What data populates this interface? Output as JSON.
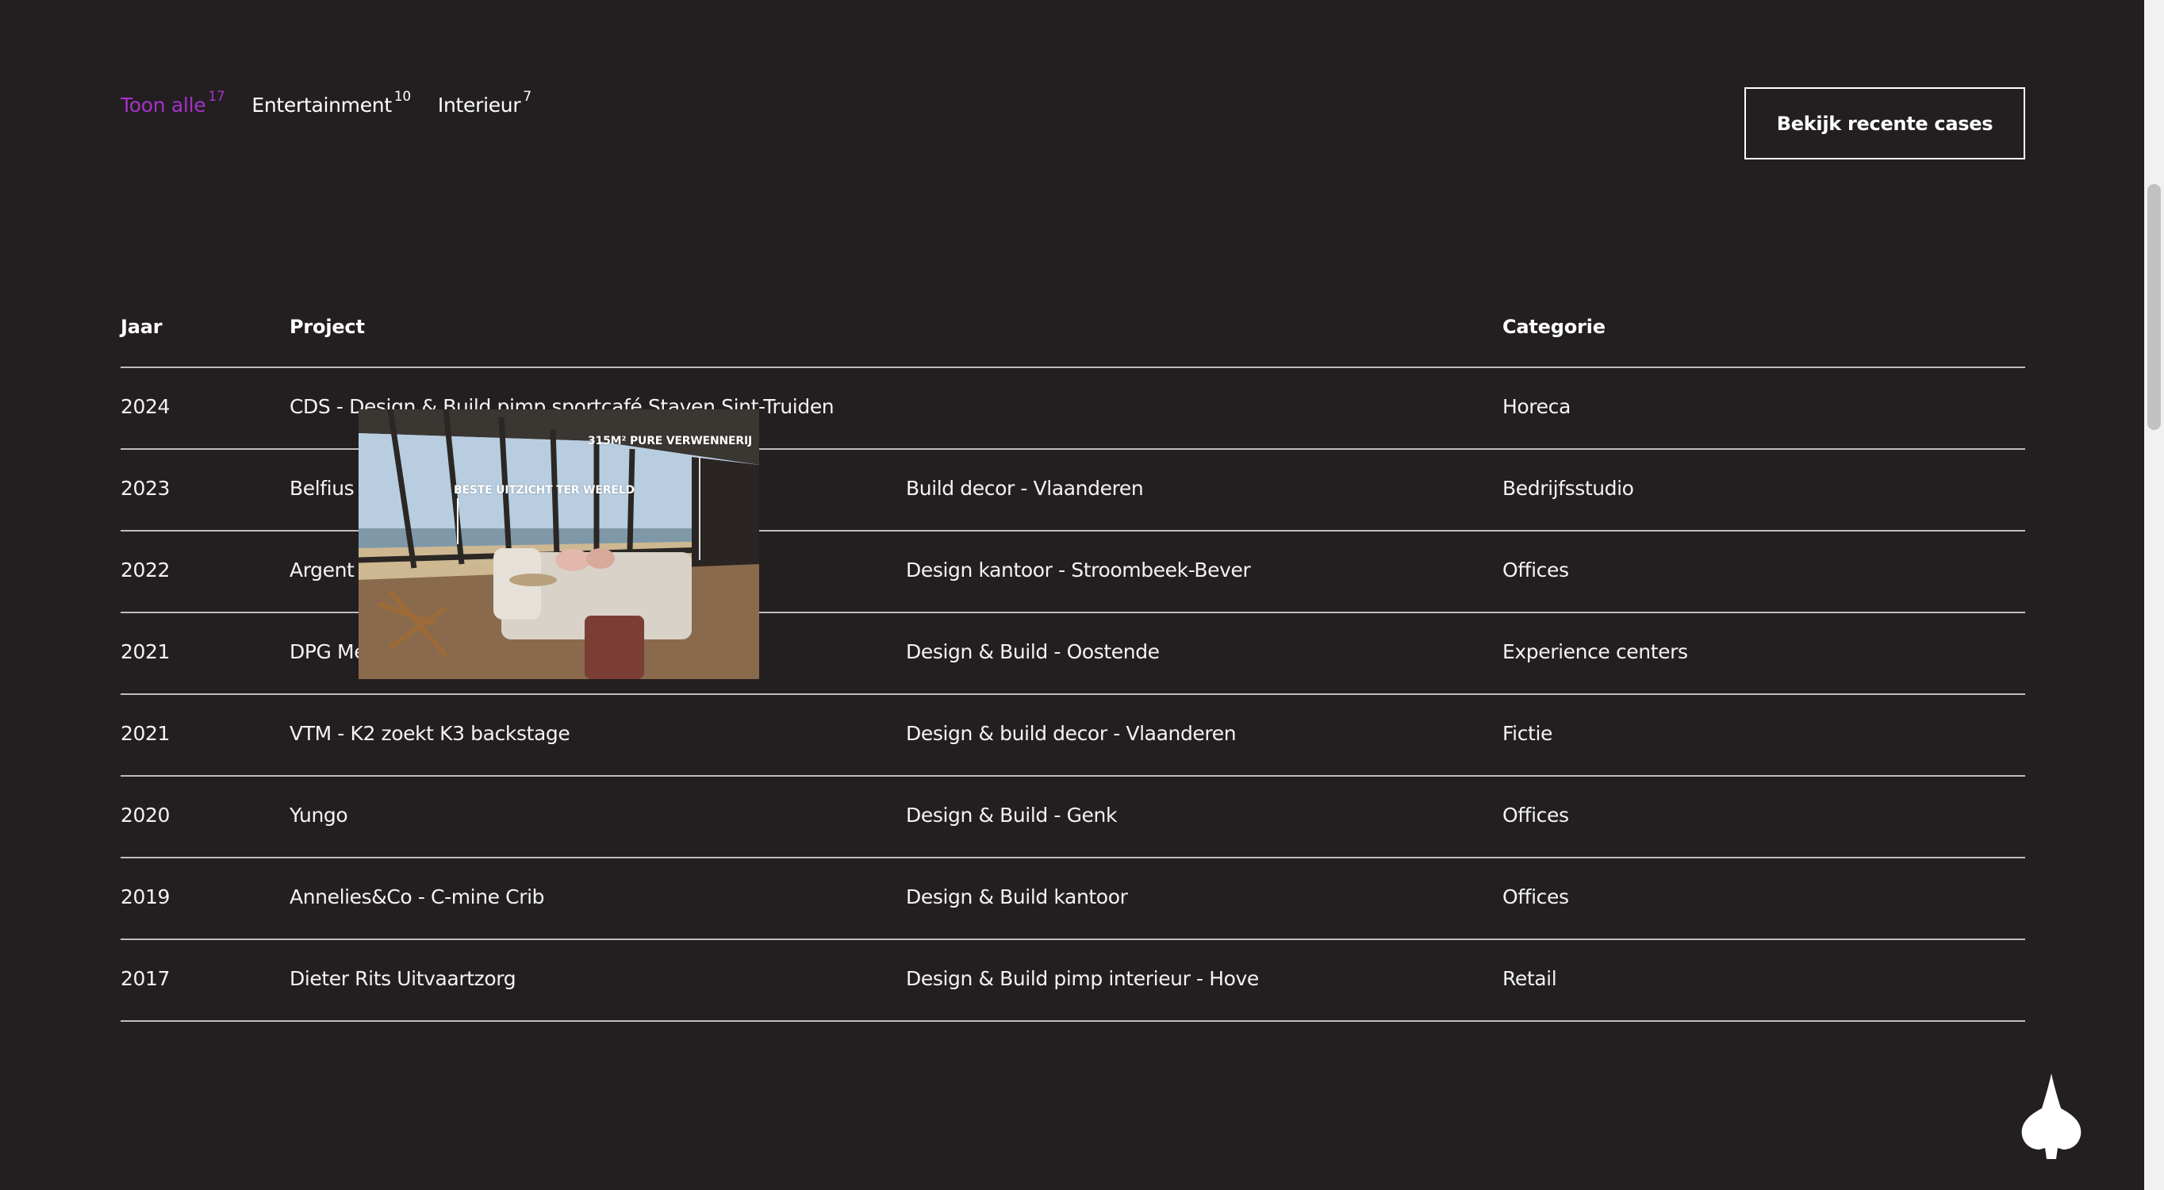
{
  "filters": [
    {
      "label": "Toon alle",
      "count": "17",
      "active": true
    },
    {
      "label": "Entertainment",
      "count": "10",
      "active": false
    },
    {
      "label": "Interieur",
      "count": "7",
      "active": false
    }
  ],
  "cta": {
    "label": "Bekijk recente cases"
  },
  "table": {
    "headers": {
      "year": "Jaar",
      "project": "Project",
      "category": "Categorie"
    },
    "rows": [
      {
        "year": "2024",
        "project": "CDS - Design & Build pimp sportcafé Staven Sint-Truiden",
        "description": "",
        "category": "Horeca"
      },
      {
        "year": "2023",
        "project": "Belfius -",
        "description": "Build decor - Vlaanderen",
        "category": "Bedrijfsstudio"
      },
      {
        "year": "2022",
        "project": "Argent",
        "description": "Design kantoor - Stroombeek-Bever",
        "category": "Offices"
      },
      {
        "year": "2021",
        "project": "DPG Me",
        "description": "Design & Build - Oostende",
        "category": "Experience centers"
      },
      {
        "year": "2021",
        "project": "VTM - K2 zoekt K3 backstage",
        "description": "Design & build decor - Vlaanderen",
        "category": "Fictie"
      },
      {
        "year": "2020",
        "project": "Yungo",
        "description": "Design & Build - Genk",
        "category": "Offices"
      },
      {
        "year": "2019",
        "project": "Annelies&Co - C-mine Crib",
        "description": "Design & Build kantoor",
        "category": "Offices"
      },
      {
        "year": "2017",
        "project": "Dieter Rits Uitvaartzorg",
        "description": "Design & Build pimp interieur - Hove",
        "category": "Retail"
      }
    ]
  },
  "preview": {
    "caption_left": "BESTE UITZICHT TER WERELD",
    "caption_right": "315M² PURE VERWENNERIJ"
  },
  "colors": {
    "background": "#231f20",
    "accent": "#a531c9",
    "divider": "#bdbdbd"
  },
  "logo": {
    "icon": "logo-icon"
  }
}
